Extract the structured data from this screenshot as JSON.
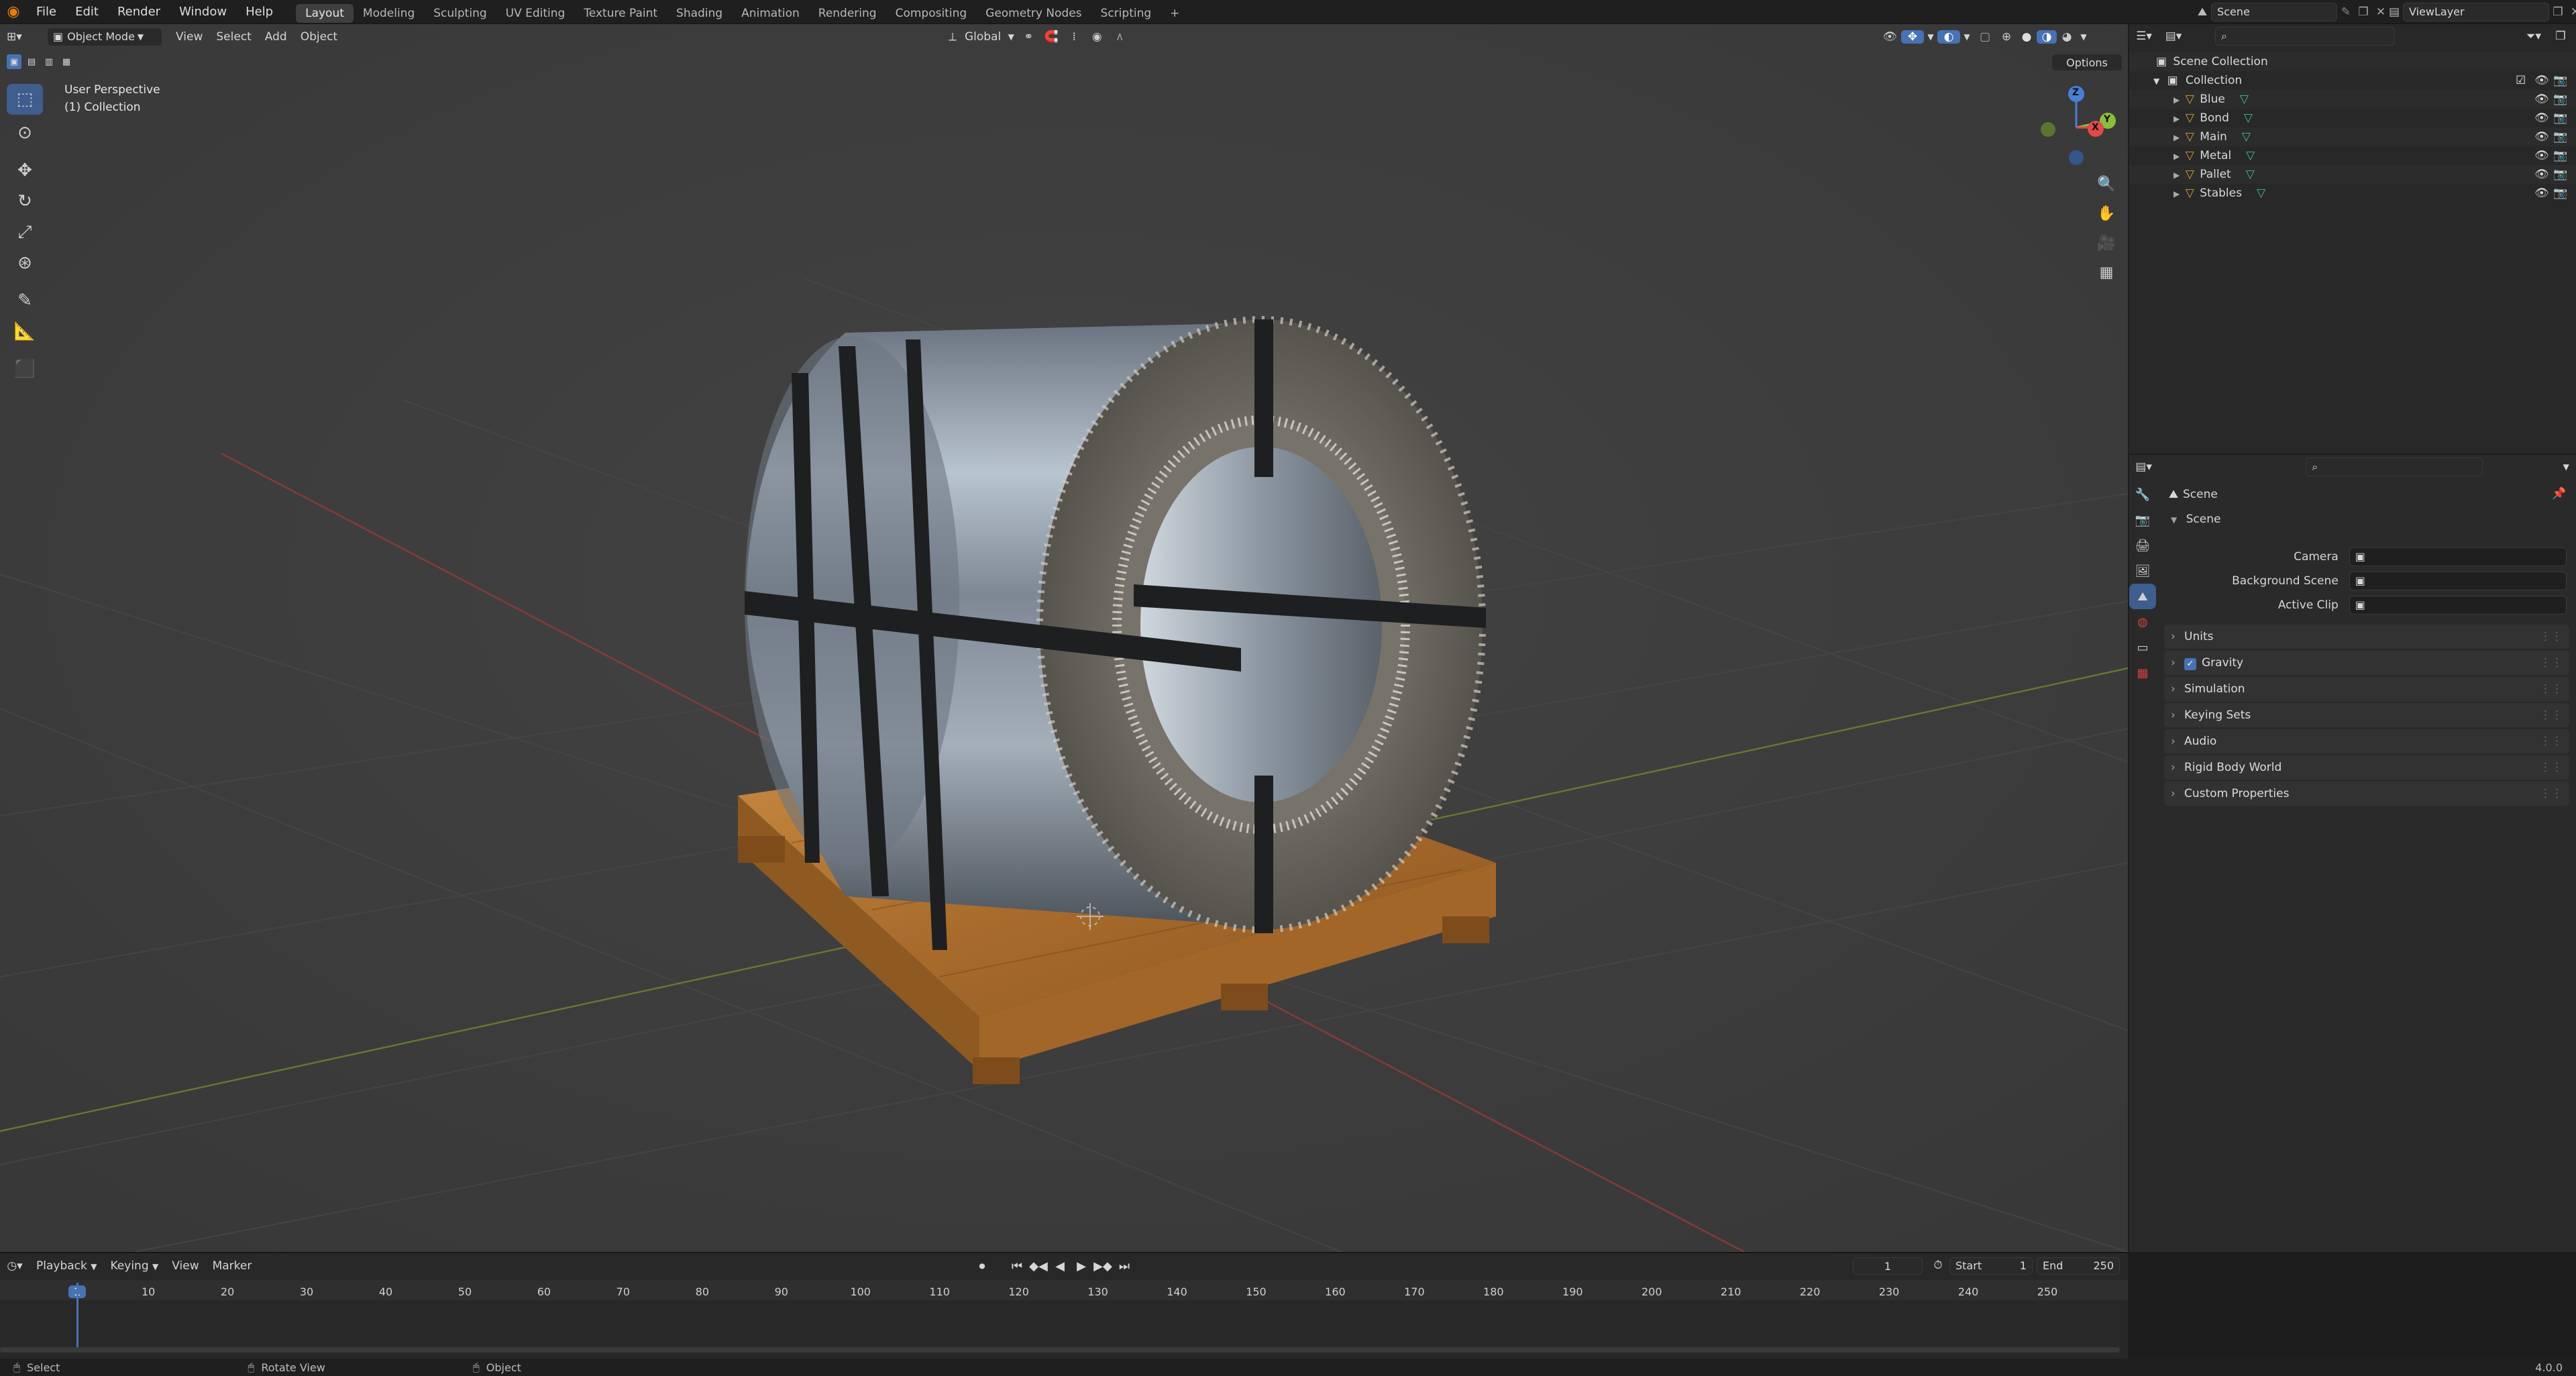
{
  "topbar": {
    "menus": [
      "File",
      "Edit",
      "Render",
      "Window",
      "Help"
    ],
    "workspaces": [
      "Layout",
      "Modeling",
      "Sculpting",
      "UV Editing",
      "Texture Paint",
      "Shading",
      "Animation",
      "Rendering",
      "Compositing",
      "Geometry Nodes",
      "Scripting"
    ],
    "add_tab": "+",
    "scene_label": "Scene",
    "view_layer_label": "ViewLayer"
  },
  "viewport": {
    "mode": "Object Mode",
    "menus": [
      "View",
      "Select",
      "Add",
      "Object"
    ],
    "transform_orientation": "Global",
    "options_label": "Options",
    "perspective_label": "User Perspective",
    "collection_label": "(1) Collection",
    "gizmo_axes": {
      "z": "Z",
      "y": "Y",
      "x": "X"
    }
  },
  "outliner": {
    "root": "Scene Collection",
    "collection": "Collection",
    "objects": [
      "Blue",
      "Bond",
      "Main",
      "Metal",
      "Pallet",
      "Stables"
    ]
  },
  "properties": {
    "context_title": "Scene",
    "section_scene": "Scene",
    "fields": [
      {
        "label": "Camera",
        "value": ""
      },
      {
        "label": "Background Scene",
        "value": ""
      },
      {
        "label": "Active Clip",
        "value": ""
      }
    ],
    "panels": [
      "Units",
      "Gravity",
      "Simulation",
      "Keying Sets",
      "Audio",
      "Rigid Body World",
      "Custom Properties"
    ]
  },
  "timeline": {
    "menus": [
      "Playback",
      "Keying",
      "View",
      "Marker"
    ],
    "current_frame": "1",
    "start_label": "Start",
    "start_value": "1",
    "end_label": "End",
    "end_value": "250",
    "ruler": [
      "1",
      "10",
      "20",
      "30",
      "40",
      "50",
      "60",
      "70",
      "80",
      "90",
      "100",
      "110",
      "120",
      "130",
      "140",
      "150",
      "160",
      "170",
      "180",
      "190",
      "200",
      "210",
      "220",
      "230",
      "240",
      "250"
    ]
  },
  "statusbar": {
    "items": [
      "Select",
      "Rotate View",
      "Object"
    ],
    "version": "4.0.0"
  },
  "colors": {
    "accent": "#4772b3",
    "mesh_icon": "#e0a030",
    "tri_icon": "#3fbf8f",
    "viewport_bg": "#3d3d3d",
    "wood": "#b77a35",
    "steel": "#8b96a2"
  }
}
